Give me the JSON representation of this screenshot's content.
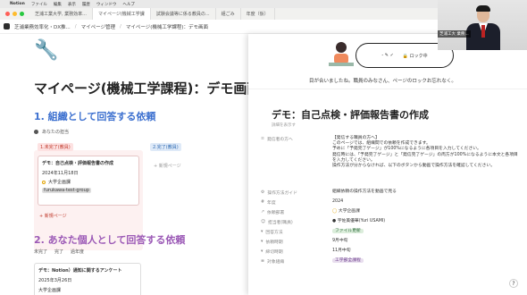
{
  "menubar": {
    "app": "Notion",
    "items": [
      "ファイル",
      "編集",
      "表示",
      "履歴",
      "ウィンドウ",
      "ヘルプ"
    ]
  },
  "tabs": [
    {
      "label": "芝浦工業大学, 業務効率...",
      "active": false
    },
    {
      "label": "マイページ(機械工学課",
      "active": true
    },
    {
      "label": "試験会議等に係る教員の...",
      "active": false
    },
    {
      "label": "組ごみ",
      "active": false
    },
    {
      "label": "年度（仮）",
      "active": false
    }
  ],
  "topbar": {
    "workspace": "芝浦業務効率化・DX推...",
    "crumb1": "マイページ管理",
    "crumb2": "マイページ(機械工学課程)：デモ画面"
  },
  "left": {
    "title": "マイページ(機械工学課程)：デモ画面",
    "section1": "1.  組織として回答する依頼",
    "owner": "あなたの担当",
    "col1": "1.未完了(教員)",
    "col2": "2.完了(教員)",
    "card": {
      "title": "デモ：自己点検・評価報告書の作成",
      "date": "2024年11月18日",
      "dept": "大学企画課",
      "group": "furukawa-test-group"
    },
    "new_page": "+ 新規ページ",
    "new_page2": "+ 新規ページ",
    "section2": "2.  あなた個人として回答する依頼",
    "filters": [
      "未完了",
      "完了",
      "過年度"
    ],
    "card2": {
      "title": "デモ：Notion）通知に関するアンケート",
      "date": "2025年3月26日",
      "dept": "大学企画課"
    }
  },
  "peek": {
    "banner_note": "目が合いましたね。職員のみなさん、ページのロックお忘れなく。",
    "ctrl_left": "- ✎ ✓",
    "ctrl_right": "🔒 ロック中",
    "title": "デモ：自己点検・評価報告書の作成",
    "subtitle": "詳細を表示す",
    "props": [
      {
        "k": "発信者の方へ",
        "v": "【発信する職員の方へ】\nこのページでは、組織間での依頼を作成できます。\n予めに「予発完了ゲージ」が100%になるように各項目を入力してください。\n発信時には、「予発完了ゲージ」と「発信完了ゲージ」の両方が100%になるように本文と各項目を入力してください。\n操作方法が分からなければ、以下のボタンから動画で操作方法を確認してください。"
      },
      {
        "k": "操作方法ガイド",
        "v": "組織依頼の操作方法を動画で見る"
      },
      {
        "k": "年度",
        "v": "2024"
      },
      {
        "k": "依頼部署",
        "v": "大学企画課"
      },
      {
        "k": "担当者(職員)",
        "v": "宇佐美優華(Yuri USAMI)"
      },
      {
        "k": "回答方法",
        "v": "ファイル更新"
      },
      {
        "k": "依頼時期",
        "v": "9月中旬"
      },
      {
        "k": "締切時期",
        "v": "11月中旬"
      },
      {
        "k": "対象組織",
        "v": "工学部全課程"
      }
    ]
  },
  "webcam": {
    "label": "芝浦工大 業務..."
  },
  "help": "?"
}
